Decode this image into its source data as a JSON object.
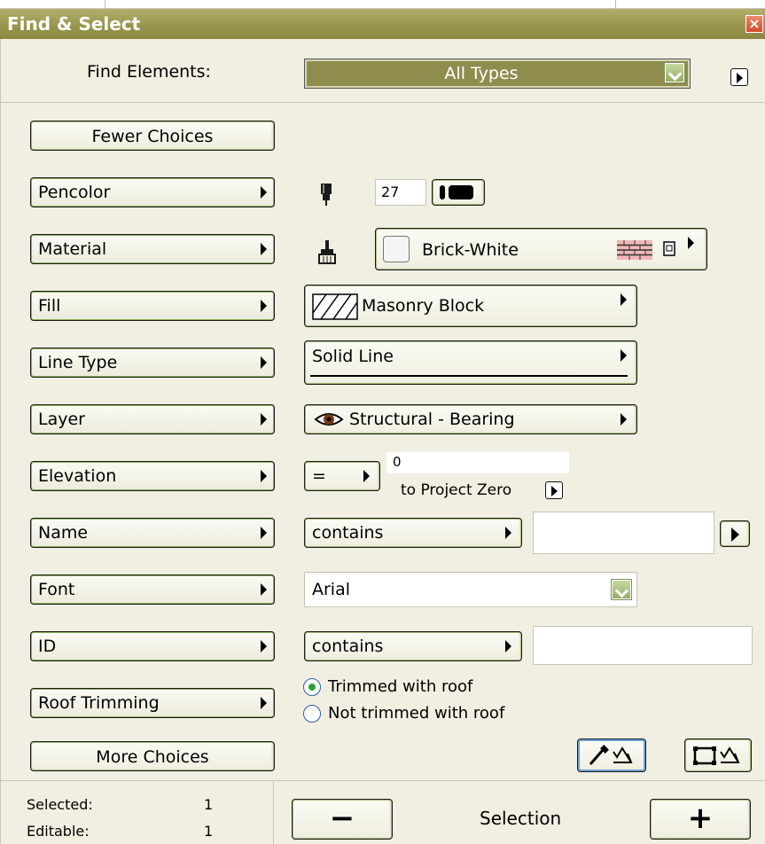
{
  "window": {
    "title": "Find & Select",
    "close_icon": "close-icon"
  },
  "find": {
    "label": "Find Elements:",
    "value": "All Types"
  },
  "buttons": {
    "fewer": "Fewer Choices",
    "more": "More Choices"
  },
  "criteria": {
    "pencolor": {
      "label": "Pencolor",
      "value": "27"
    },
    "material": {
      "label": "Material",
      "value": "Brick-White"
    },
    "fill": {
      "label": "Fill",
      "value": "Masonry Block"
    },
    "linetype": {
      "label": "Line Type",
      "value": "Solid Line"
    },
    "layer": {
      "label": "Layer",
      "value": "Structural - Bearing"
    },
    "elevation": {
      "label": "Elevation",
      "operator": "=",
      "value": "0",
      "reference": "to Project Zero"
    },
    "name": {
      "label": "Name",
      "operator": "contains",
      "value": ""
    },
    "font": {
      "label": "Font",
      "value": "Arial"
    },
    "id": {
      "label": "ID",
      "operator": "contains",
      "value": ""
    },
    "roof": {
      "label": "Roof Trimming",
      "option1": "Trimmed with roof",
      "option2": "Not trimmed with roof",
      "selected": "Trimmed with roof"
    }
  },
  "footer": {
    "selected_label": "Selected:",
    "selected_value": "1",
    "editable_label": "Editable:",
    "editable_value": "1",
    "selection_label": "Selection",
    "minus": "−",
    "plus": "+"
  },
  "colors": {
    "titlebar": "#9c9a55",
    "panel": "#f1efe2",
    "accent_green": "#8f8d4d"
  }
}
